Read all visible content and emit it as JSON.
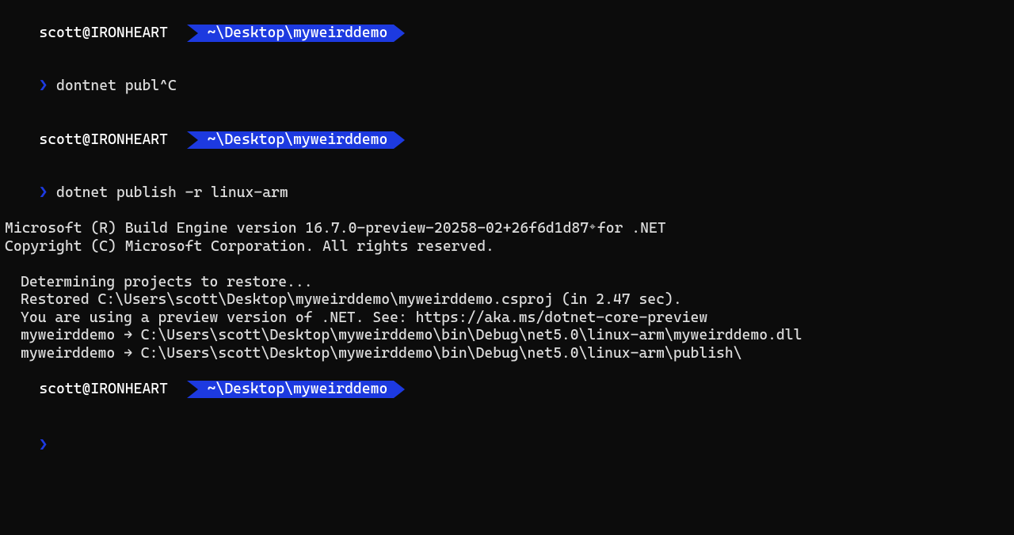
{
  "prompt": {
    "userhost": "scott@IRONHEART",
    "path": "~\\Desktop\\myweirddemo",
    "symbol": "❯"
  },
  "lines": {
    "cmd1": "dontnet publ^C",
    "cmd1_actual": "dontnet publ",
    "cmd1_ctrlc": "^C",
    "cmd2": "dotnet publish -r linux-arm",
    "out1": "Microsoft (R) Build Engine version 16.7.0-preview-20258-02+26f6d1d87 for .NET",
    "out2": "Copyright (C) Microsoft Corporation. All rights reserved.",
    "blank": "",
    "out3": "Determining projects to restore...",
    "out4": "Restored C:\\Users\\scott\\Desktop\\myweirddemo\\myweirddemo.csproj (in 2.47 sec).",
    "out5": "You are using a preview version of .NET. See: https://aka.ms/dotnet-core-preview",
    "out6": "myweirddemo → C:\\Users\\scott\\Desktop\\myweirddemo\\bin\\Debug\\net5.0\\linux-arm\\myweirddemo.dll",
    "out7": "myweirddemo → C:\\Users\\scott\\Desktop\\myweirddemo\\bin\\Debug\\net5.0\\linux-arm\\publish\\"
  }
}
